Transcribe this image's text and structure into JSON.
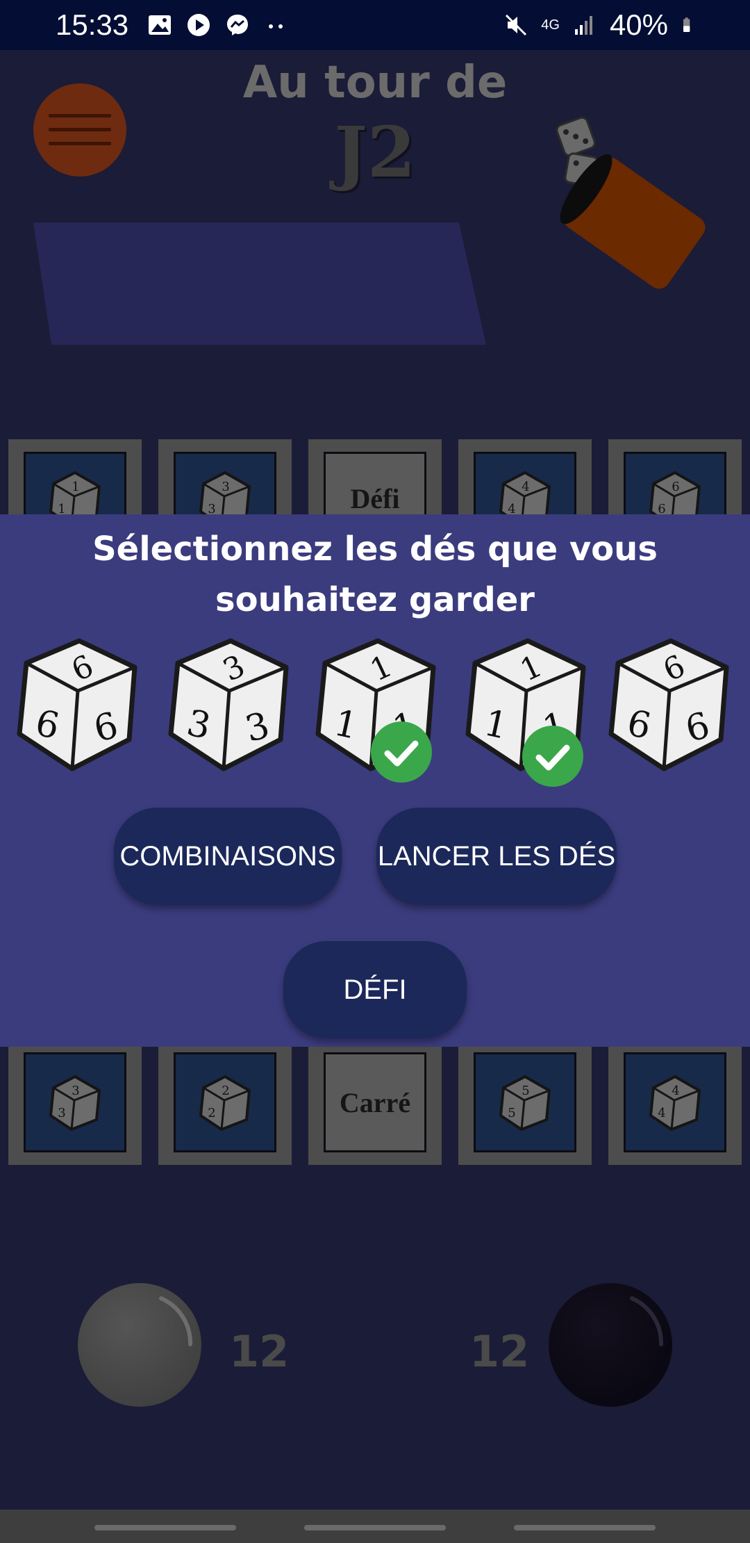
{
  "status_bar": {
    "time": "15:33",
    "network": "4G",
    "battery": "40%",
    "icons_left": [
      "image-icon",
      "play-icon",
      "messenger-icon",
      "more-dots-icon"
    ],
    "icons_right": [
      "mute-icon",
      "network-icon",
      "signal-icon",
      "battery-icon"
    ]
  },
  "header": {
    "turn_label": "Au tour de",
    "player_name": "J2"
  },
  "top_tiles": [
    {
      "kind": "die",
      "face": 1
    },
    {
      "kind": "die",
      "face": 3
    },
    {
      "kind": "text",
      "label": "Défi"
    },
    {
      "kind": "die",
      "face": 4
    },
    {
      "kind": "die",
      "face": 6
    }
  ],
  "bottom_tiles": [
    {
      "kind": "die",
      "face": 3
    },
    {
      "kind": "die",
      "face": 2
    },
    {
      "kind": "text",
      "label": "Carré"
    },
    {
      "kind": "die",
      "face": 5
    },
    {
      "kind": "die",
      "face": 4
    }
  ],
  "dialog": {
    "title_line1": "Sélectionnez les dés que vous",
    "title_line2": "souhaitez garder",
    "dice": [
      {
        "face": "6",
        "selected": false
      },
      {
        "face": "3",
        "selected": false
      },
      {
        "face": "1",
        "selected": true
      },
      {
        "face": "1",
        "selected": true
      },
      {
        "face": "6",
        "selected": false
      }
    ],
    "combinations_label": "COMBINAISONS",
    "roll_label": "LANCER LES DÉS",
    "challenge_label": "DÉFI"
  },
  "players": [
    {
      "score": "12",
      "color": "#4a4a4a"
    },
    {
      "score": "12",
      "color": "#0a0812"
    }
  ],
  "colors": {
    "dialog_bg": "#3b3c7e",
    "button_bg": "#1b2859",
    "check_green": "#3aa74a",
    "cup_orange": "#6b2a00"
  }
}
